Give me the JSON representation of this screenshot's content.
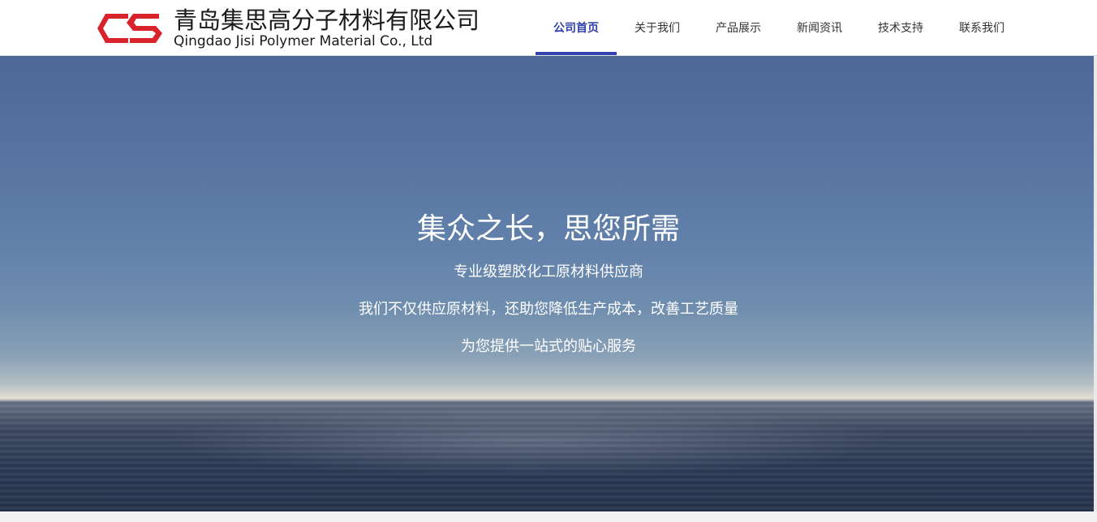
{
  "brand": {
    "name_cn": "青岛集思高分子材料有限公司",
    "name_en": "Qingdao Jisi Polymer Material Co., Ltd",
    "logo_color": "#d8232a",
    "logo_icon": "js-monogram-icon"
  },
  "nav": {
    "items": [
      {
        "label": "公司首页",
        "active": true
      },
      {
        "label": "关于我们",
        "active": false
      },
      {
        "label": "产品展示",
        "active": false
      },
      {
        "label": "新闻资讯",
        "active": false
      },
      {
        "label": "技术支持",
        "active": false
      },
      {
        "label": "联系我们",
        "active": false
      }
    ],
    "active_color": "#3343b0"
  },
  "hero": {
    "title": "集众之长，思您所需",
    "line1": "专业级塑胶化工原材料供应商",
    "line2": "我们不仅供应原材料，还助您降低生产成本，改善工艺质量",
    "line3": "为您提供一站式的贴心服务"
  }
}
